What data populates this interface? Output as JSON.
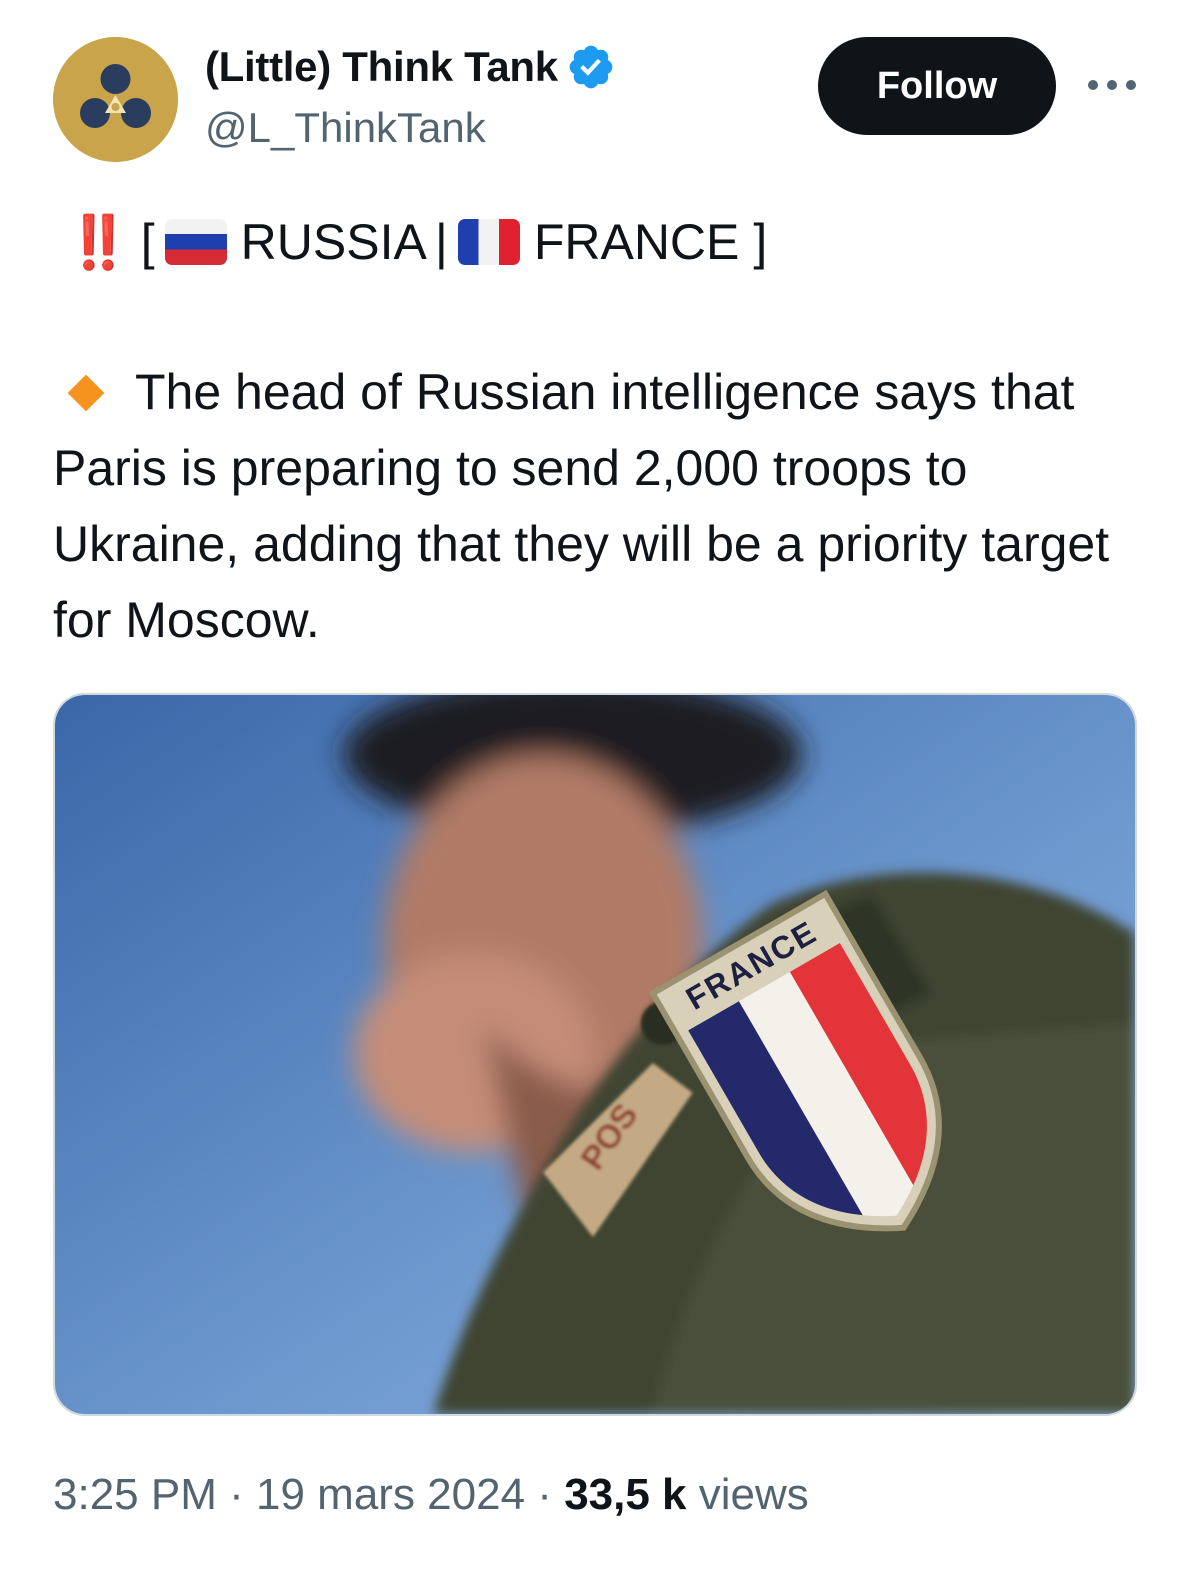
{
  "author": {
    "display_name": "(Little) Think Tank",
    "handle": "@L_ThinkTank",
    "verified": true,
    "avatar_icon": "think-tank-logo-icon",
    "verified_icon": "verified-badge-icon"
  },
  "actions": {
    "follow_label": "Follow",
    "more_icon": "more-options-icon"
  },
  "tweet": {
    "header": {
      "alert": "‼️",
      "open_bracket": "[",
      "flag_1_icon": "russia-flag-icon",
      "country_1": "RUSSIA",
      "separator": "|",
      "flag_2_icon": "france-flag-icon",
      "country_2": "FRANCE",
      "close_bracket": "]"
    },
    "bullet_icon": "orange-diamond-icon",
    "body": "The head of Russian intelligence says that Paris is preparing to send 2,000 troops to Ukraine, adding that they will be a priority target for Moscow.",
    "image": {
      "patch_text": "FRANCE",
      "tab_text": "POS"
    }
  },
  "meta": {
    "time": "3:25 PM",
    "dot_1": "·",
    "date": "19 mars 2024",
    "dot_2": "·",
    "views_count": "33,5 k",
    "views_label": "views"
  },
  "colors": {
    "follow_bg": "#0f1419",
    "secondary_text": "#536471",
    "verified_blue": "#1d9bf0",
    "diamond_orange": "#f6921e",
    "alert_red": "#e0242f"
  }
}
